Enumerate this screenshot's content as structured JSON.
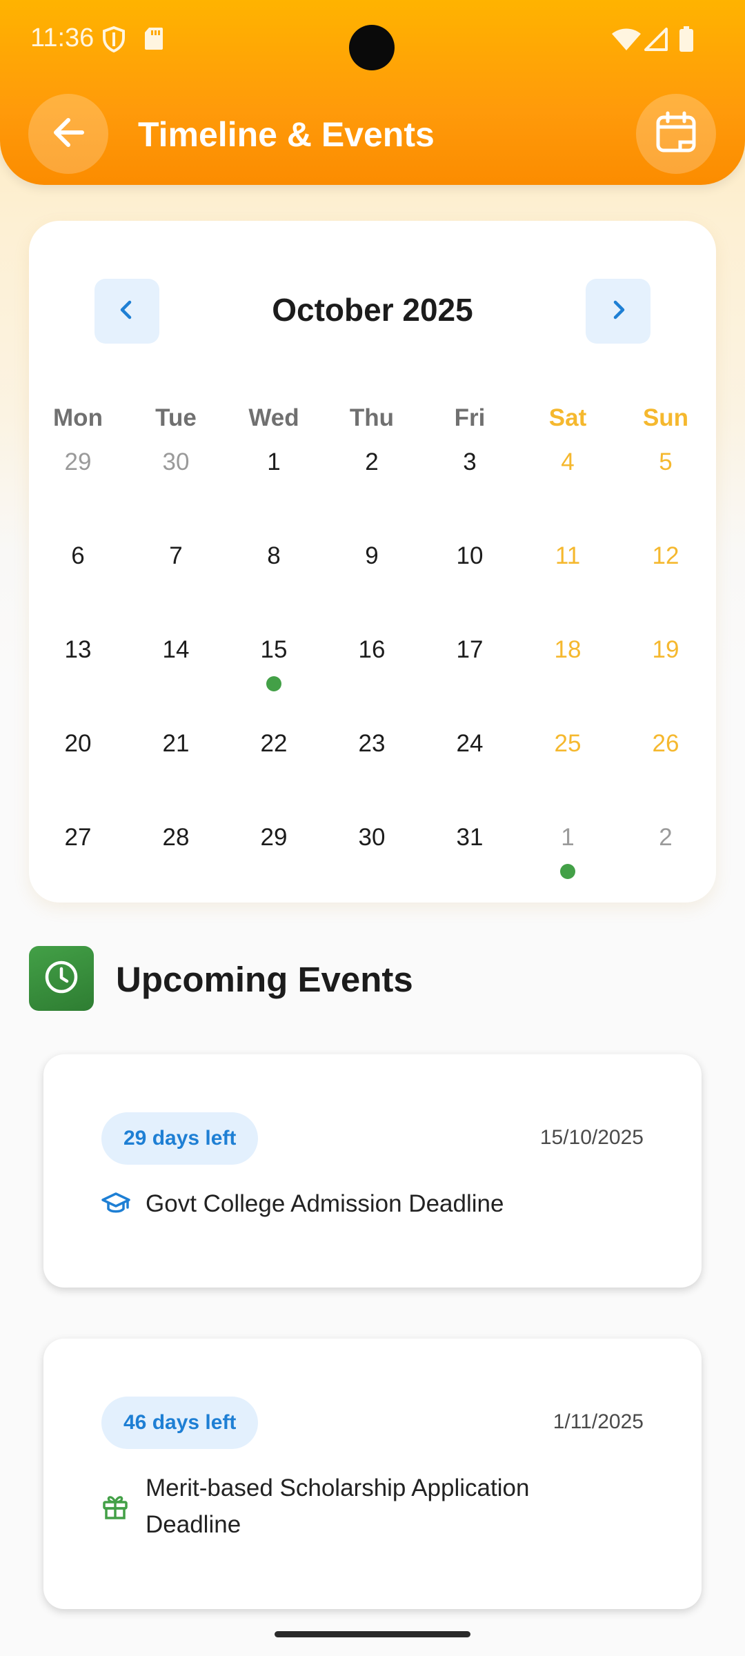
{
  "status": {
    "time": "11:36"
  },
  "header": {
    "title": "Timeline & Events"
  },
  "calendar": {
    "month_label": "October 2025",
    "weekdays": [
      "Mon",
      "Tue",
      "Wed",
      "Thu",
      "Fri",
      "Sat",
      "Sun"
    ],
    "weeks": [
      [
        {
          "d": "29",
          "t": "other"
        },
        {
          "d": "30",
          "t": "other"
        },
        {
          "d": "1"
        },
        {
          "d": "2"
        },
        {
          "d": "3"
        },
        {
          "d": "4",
          "t": "weekend"
        },
        {
          "d": "5",
          "t": "weekend"
        }
      ],
      [
        {
          "d": "6"
        },
        {
          "d": "7"
        },
        {
          "d": "8"
        },
        {
          "d": "9"
        },
        {
          "d": "10"
        },
        {
          "d": "11",
          "t": "weekend"
        },
        {
          "d": "12",
          "t": "weekend"
        }
      ],
      [
        {
          "d": "13"
        },
        {
          "d": "14"
        },
        {
          "d": "15",
          "event": true
        },
        {
          "d": "16"
        },
        {
          "d": "17"
        },
        {
          "d": "18",
          "t": "weekend"
        },
        {
          "d": "19",
          "t": "weekend"
        }
      ],
      [
        {
          "d": "20"
        },
        {
          "d": "21"
        },
        {
          "d": "22"
        },
        {
          "d": "23"
        },
        {
          "d": "24"
        },
        {
          "d": "25",
          "t": "weekend"
        },
        {
          "d": "26",
          "t": "weekend"
        }
      ],
      [
        {
          "d": "27"
        },
        {
          "d": "28"
        },
        {
          "d": "29"
        },
        {
          "d": "30"
        },
        {
          "d": "31"
        },
        {
          "d": "1",
          "t": "other",
          "event": true
        },
        {
          "d": "2",
          "t": "other"
        }
      ]
    ],
    "colors": {
      "weekend": "#f5b82e",
      "event_dot": "#43a047",
      "nav_accent": "#1e7fd4"
    }
  },
  "upcoming": {
    "title": "Upcoming Events",
    "events": [
      {
        "days_left": "29 days left",
        "date": "15/10/2025",
        "title": "Govt College Admission Deadline",
        "icon": "graduation-cap-icon"
      },
      {
        "days_left": "46 days left",
        "date": "1/11/2025",
        "title": "Merit-based Scholarship Application Deadline",
        "icon": "gift-icon"
      }
    ]
  }
}
